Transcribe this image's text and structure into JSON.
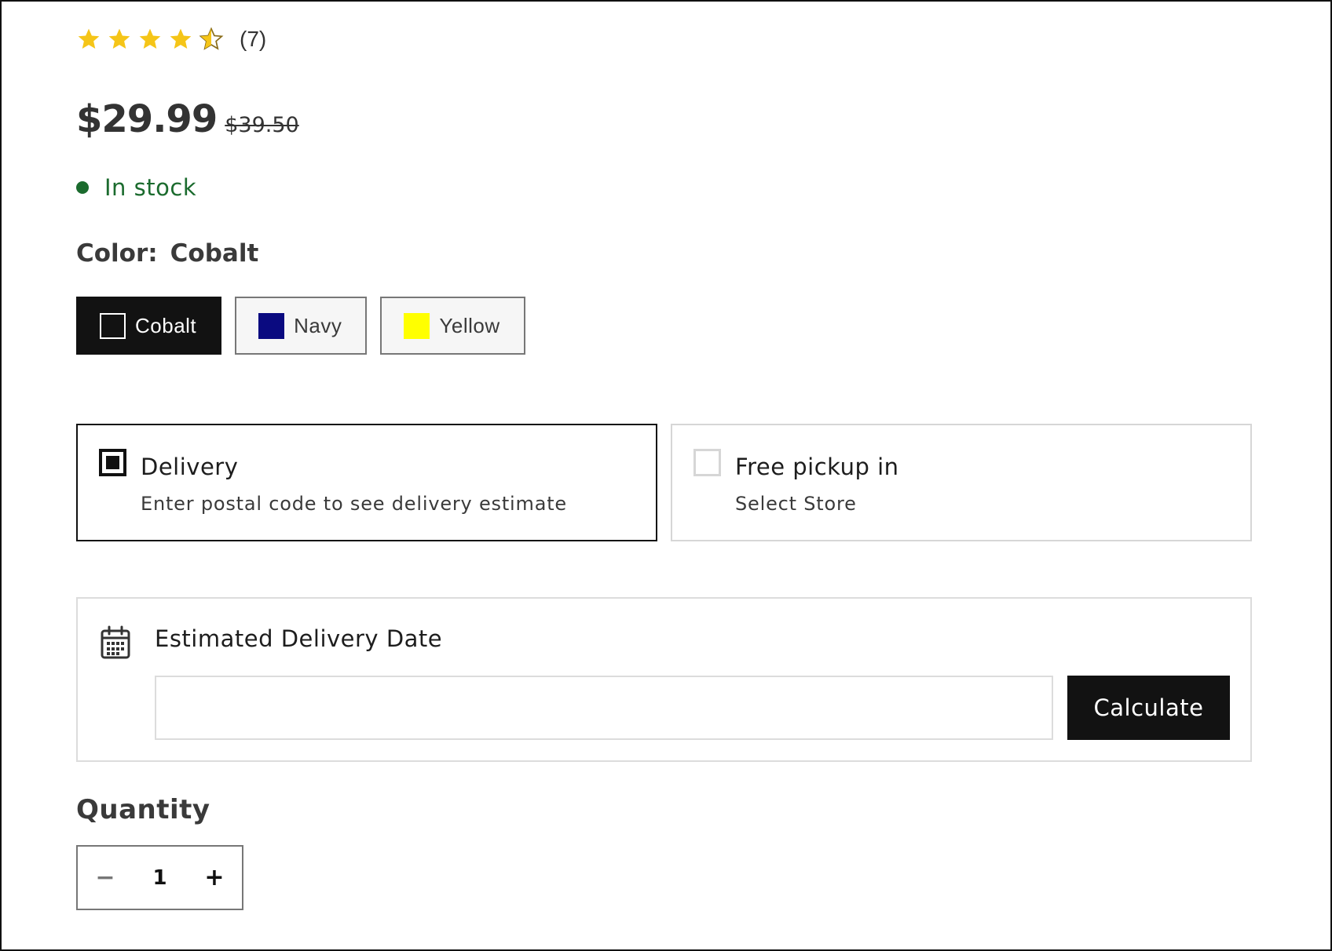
{
  "colors": {
    "star": "#f5c518",
    "stock": "#1b6b2e",
    "button_dark": "#121212"
  },
  "rating": {
    "stars": 4.5,
    "stars_max": 5,
    "count_label": "(7)"
  },
  "price": {
    "current": "$29.99",
    "compare_at": "$39.50"
  },
  "stock": {
    "label": "In stock"
  },
  "color": {
    "label": "Color:",
    "selected_value": "Cobalt",
    "options": [
      {
        "label": "Cobalt",
        "swatch": "#121212",
        "selected": true
      },
      {
        "label": "Navy",
        "swatch": "#0a0a80",
        "selected": false
      },
      {
        "label": "Yellow",
        "swatch": "#ffff00",
        "selected": false
      }
    ]
  },
  "fulfillment": {
    "delivery": {
      "title": "Delivery",
      "subtitle": "Enter postal code to see delivery estimate",
      "selected": true
    },
    "pickup": {
      "title": "Free pickup in",
      "subtitle": "Select Store",
      "selected": false
    }
  },
  "estimate": {
    "icon": "calendar-icon",
    "title": "Estimated Delivery Date",
    "input_value": "",
    "button_label": "Calculate"
  },
  "quantity": {
    "label": "Quantity",
    "minus": "−",
    "plus": "+",
    "value": "1"
  }
}
